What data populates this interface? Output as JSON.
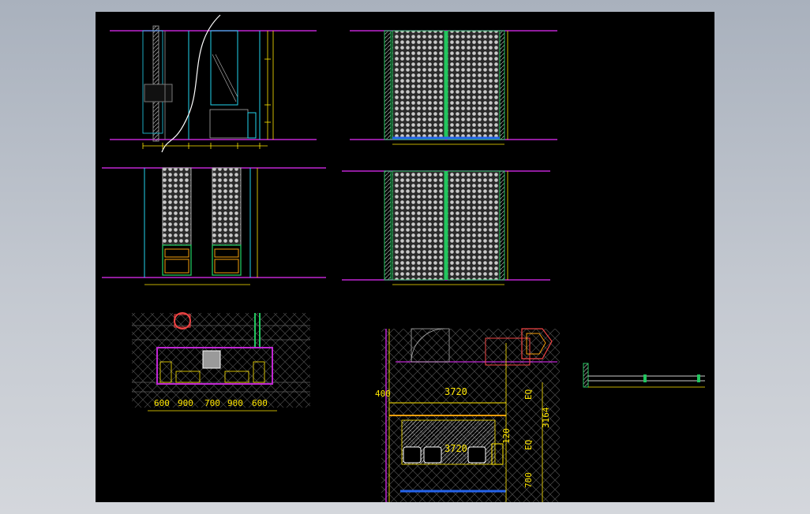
{
  "colors": {
    "background": "#000000",
    "frame": "#aab2be",
    "floor_line": "#c026d3",
    "cyan": "#22d3ee",
    "yellow": "#ffe600",
    "green": "#22c55e",
    "red": "#ef4444",
    "white": "#ffffff",
    "orange": "#f59e0b",
    "panel": "#bdbdbd"
  },
  "dimensions": {
    "plan_left": [
      "600",
      "900",
      "700",
      "900",
      "600"
    ],
    "plan_right": {
      "top_width": "3720",
      "lower_width": "3720",
      "left_small": "400",
      "right_eq_top": "EQ",
      "right_eq_bottom": "EQ",
      "right_total": "3164",
      "right_mid": "120",
      "right_bottom": "700"
    }
  }
}
